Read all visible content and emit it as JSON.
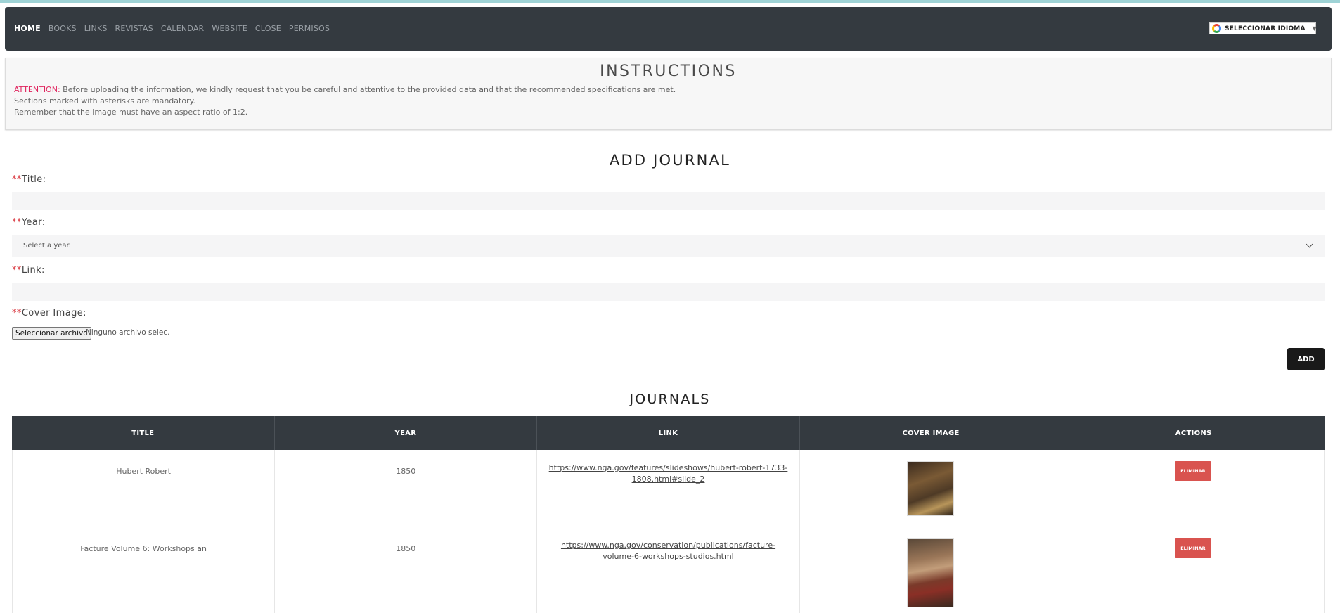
{
  "nav": {
    "items": [
      "HOME",
      "BOOKS",
      "LINKS",
      "REVISTAS",
      "CALENDAR",
      "WEBSITE",
      "CLOSE",
      "PERMISOS"
    ],
    "language_label": "SELECCIONAR IDIOMA",
    "language_arrow": "▼"
  },
  "instructions": {
    "title": "INSTRUCTIONS",
    "attention_label": "ATTENTION:",
    "line1": " Before uploading the information, we kindly request that you be careful and attentive to the provided data and that the recommended specifications are met.",
    "line2": "Sections marked with asterisks are mandatory.",
    "line3": "Remember that the image must have an aspect ratio of 1:2."
  },
  "form": {
    "title": "ADD JOURNAL",
    "required_mark": "**",
    "title_label": "Title:",
    "year_label": "Year:",
    "year_placeholder": "Select a year.",
    "link_label": "Link:",
    "cover_label": "Cover Image:",
    "file_button": "Seleccionar archivo",
    "file_status": "Ninguno archivo selec.",
    "add_button": "ADD"
  },
  "table": {
    "title": "JOURNALS",
    "headers": [
      "TITLE",
      "YEAR",
      "LINK",
      "COVER IMAGE",
      "ACTIONS"
    ],
    "rows": [
      {
        "title": "Hubert Robert",
        "year": "1850",
        "link": "https://www.nga.gov/features/slideshows/hubert-robert-1733-1808.html#slide_2",
        "action": "ELIMINAR"
      },
      {
        "title": "Facture Volume 6: Workshops an",
        "year": "1850",
        "link": "https://www.nga.gov/conservation/publications/facture-volume-6-workshops-studios.html",
        "action": "ELIMINAR"
      }
    ]
  }
}
